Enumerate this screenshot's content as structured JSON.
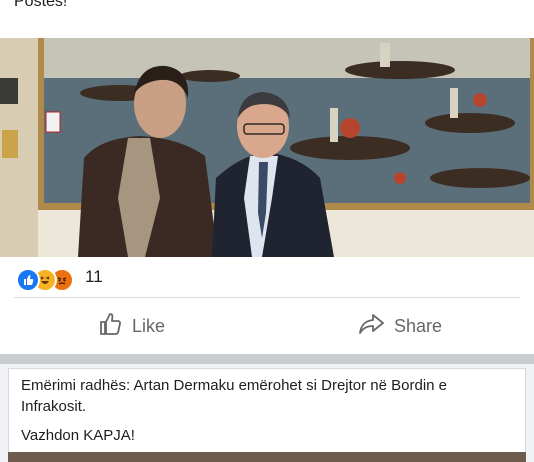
{
  "post1": {
    "text_partial": "Postës!"
  },
  "reactions": {
    "icons": [
      "like-icon",
      "haha-icon",
      "angry-icon"
    ],
    "count": "11"
  },
  "actions": {
    "like_label": "Like",
    "share_label": "Share"
  },
  "post2": {
    "line1": "Emërimi radhës: Artan Dermaku emërohet si Drejtor në Bordin e Infrakosit.",
    "line2": "Vazhdon KAPJA!"
  },
  "colors": {
    "like_blue": "#1877f2",
    "haha_yellow": "#f7b125",
    "angry_orange": "#e9710f",
    "action_gray": "#65676b"
  }
}
